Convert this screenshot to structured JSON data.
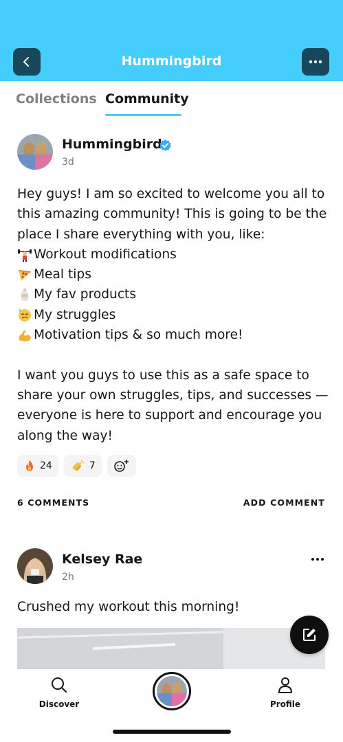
{
  "header": {
    "title": "Hummingbird",
    "back_icon": "chevron-left-icon",
    "menu_icon": "more-horizontal-icon"
  },
  "tabs": [
    {
      "label": "Collections",
      "active": false
    },
    {
      "label": "Community",
      "active": true
    }
  ],
  "post": {
    "author": "Hummingbird",
    "verified": true,
    "time": "3d",
    "lines": [
      {
        "emoji": "",
        "text": "Hey guys! I am so excited to welcome you all to"
      },
      {
        "emoji": "",
        "text": "this amazing community! This is going to be the"
      },
      {
        "emoji": "",
        "text": "place I share everything with you, like:"
      },
      {
        "emoji": "weightlifter-emoji",
        "text": "Workout modifications"
      },
      {
        "emoji": "pizza-emoji",
        "text": "Meal tips"
      },
      {
        "emoji": "bottle-emoji",
        "text": "My fav products"
      },
      {
        "emoji": "sweat-face-emoji",
        "text": "My struggles"
      },
      {
        "emoji": "flexed-biceps-emoji",
        "text": "Motivation tips & so much more!"
      },
      {
        "emoji": "",
        "text": ""
      },
      {
        "emoji": "",
        "text": "I want you guys to use this as a safe space to"
      },
      {
        "emoji": "",
        "text": "share your own struggles, tips, and successes —"
      },
      {
        "emoji": "",
        "text": "everyone is here to support and encourage you"
      },
      {
        "emoji": "",
        "text": "along the way!"
      }
    ],
    "reactions": [
      {
        "icon": "fire-emoji",
        "count": "24"
      },
      {
        "icon": "clapping-hands-emoji",
        "count": "7"
      }
    ],
    "add_reaction_icon": "add-reaction-icon",
    "comments_label": "6 COMMENTS",
    "add_comment_label": "ADD COMMENT"
  },
  "comment": {
    "author": "Kelsey Rae",
    "time": "2h",
    "text": "Crushed my workout this morning!",
    "menu_icon": "more-horizontal-icon"
  },
  "fab_icon": "compose-icon",
  "tabbar": {
    "discover_label": "Discover",
    "profile_label": "Profile"
  },
  "colors": {
    "accent": "#45CDFB",
    "header_button": "#17475A",
    "verified": "#3DA9F5"
  }
}
